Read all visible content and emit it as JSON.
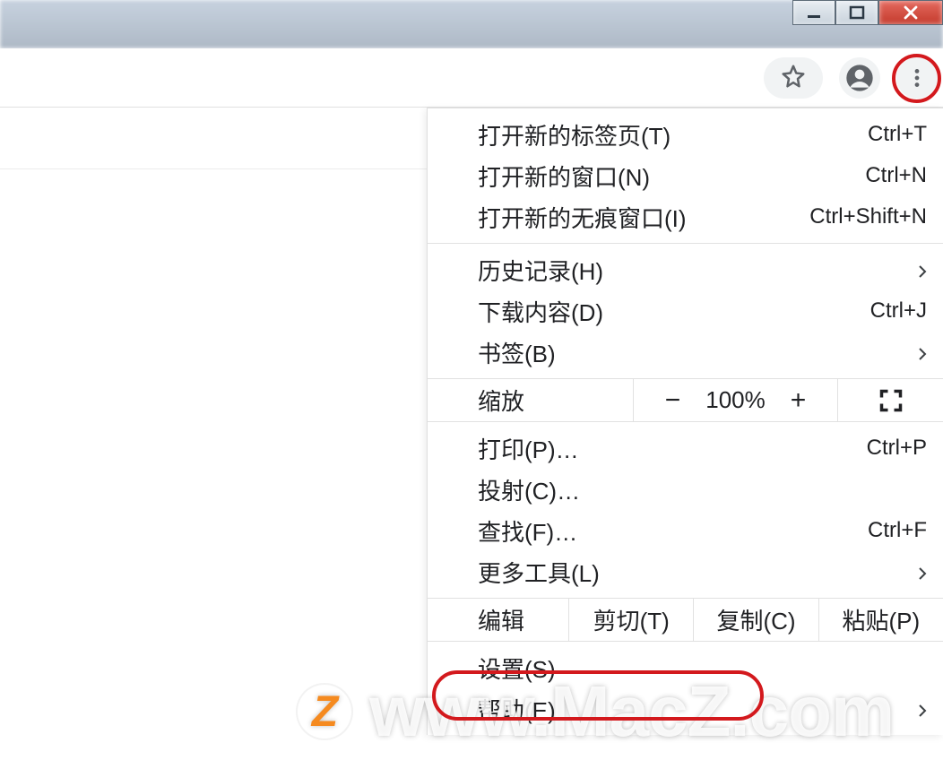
{
  "toolbar": {
    "star_icon": "star-icon",
    "profile_icon": "profile-icon",
    "menu_icon": "more-vert-icon"
  },
  "menu": {
    "section1": [
      {
        "label": "打开新的标签页(T)",
        "shortcut": "Ctrl+T"
      },
      {
        "label": "打开新的窗口(N)",
        "shortcut": "Ctrl+N"
      },
      {
        "label": "打开新的无痕窗口(I)",
        "shortcut": "Ctrl+Shift+N"
      }
    ],
    "section2": [
      {
        "label": "历史记录(H)",
        "submenu": true
      },
      {
        "label": "下载内容(D)",
        "shortcut": "Ctrl+J"
      },
      {
        "label": "书签(B)",
        "submenu": true
      }
    ],
    "zoom": {
      "label": "缩放",
      "minus": "−",
      "value": "100%",
      "plus": "+",
      "fullscreen": "fullscreen-icon"
    },
    "section3": [
      {
        "label": "打印(P)…",
        "shortcut": "Ctrl+P"
      },
      {
        "label": "投射(C)…"
      },
      {
        "label": "查找(F)…",
        "shortcut": "Ctrl+F"
      },
      {
        "label": "更多工具(L)",
        "submenu": true
      }
    ],
    "edit": {
      "label": "编辑",
      "cut": "剪切(T)",
      "copy": "复制(C)",
      "paste": "粘贴(P)"
    },
    "section4": [
      {
        "label": "设置(S)"
      },
      {
        "label": "帮助(E)",
        "submenu": true
      }
    ]
  },
  "watermark": {
    "brand_letter": "Z",
    "text": "www.MacZ.com"
  }
}
